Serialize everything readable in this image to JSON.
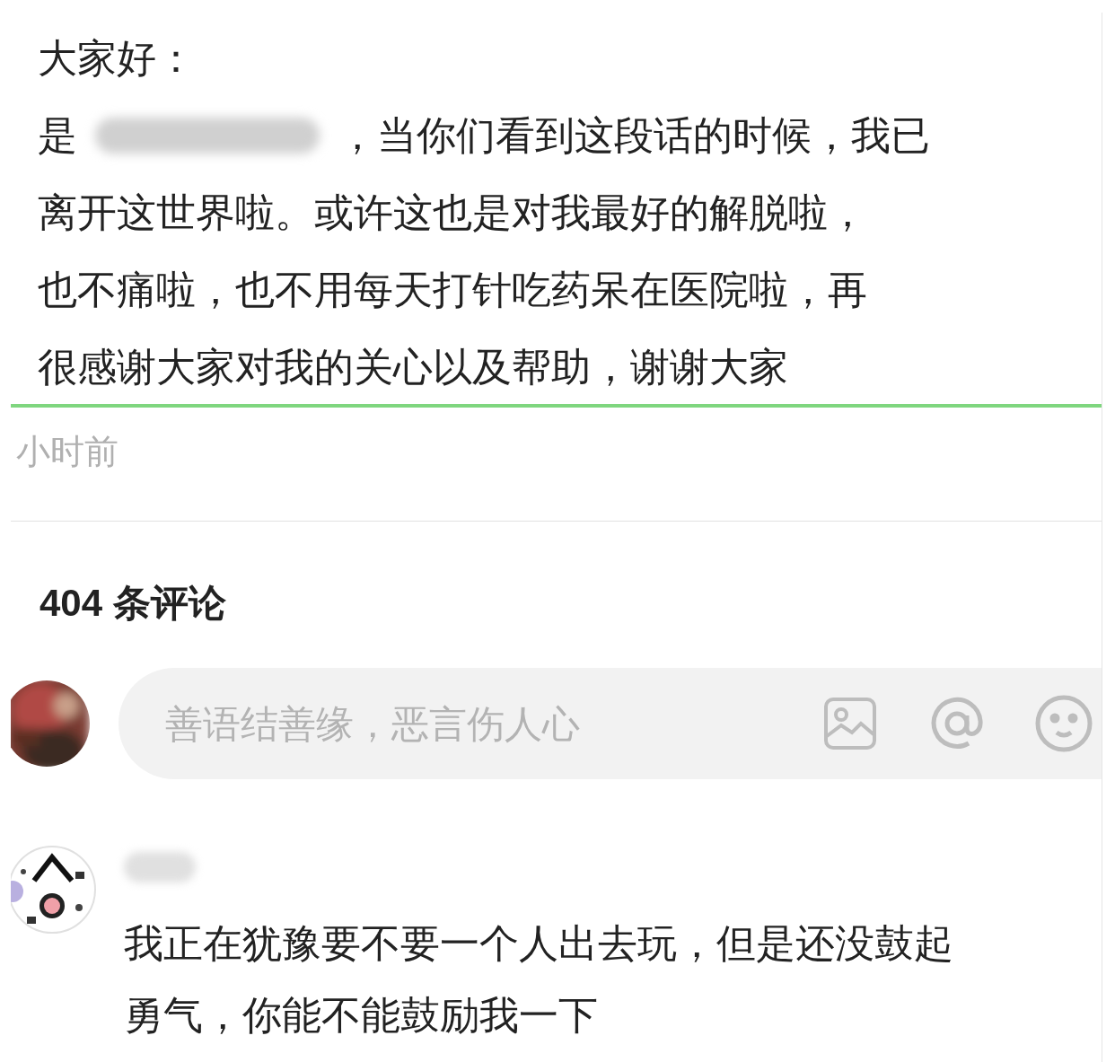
{
  "post": {
    "lines": [
      {
        "text": "大家好："
      },
      {
        "text": "是",
        "redacted_name": true,
        "after": "，当你们看到这段话的时候，我已"
      },
      {
        "text": "离开这世界啦。或许这也是对我最好的解脱啦，"
      },
      {
        "text": "也不痛啦，也不用每天打针吃药呆在医院啦，再"
      },
      {
        "text": "很感谢大家对我的关心以及帮助，谢谢大家"
      }
    ],
    "time": "小时前"
  },
  "comments": {
    "count_label": "404 条评论",
    "input": {
      "placeholder": "善语结善缘，恶言伤人心"
    },
    "items": [
      {
        "username_redacted": true,
        "lines": [
          "我正在犹豫要不要一个人出去玩，但是还没鼓起",
          "勇气，你能不能鼓励我一下"
        ]
      }
    ]
  }
}
